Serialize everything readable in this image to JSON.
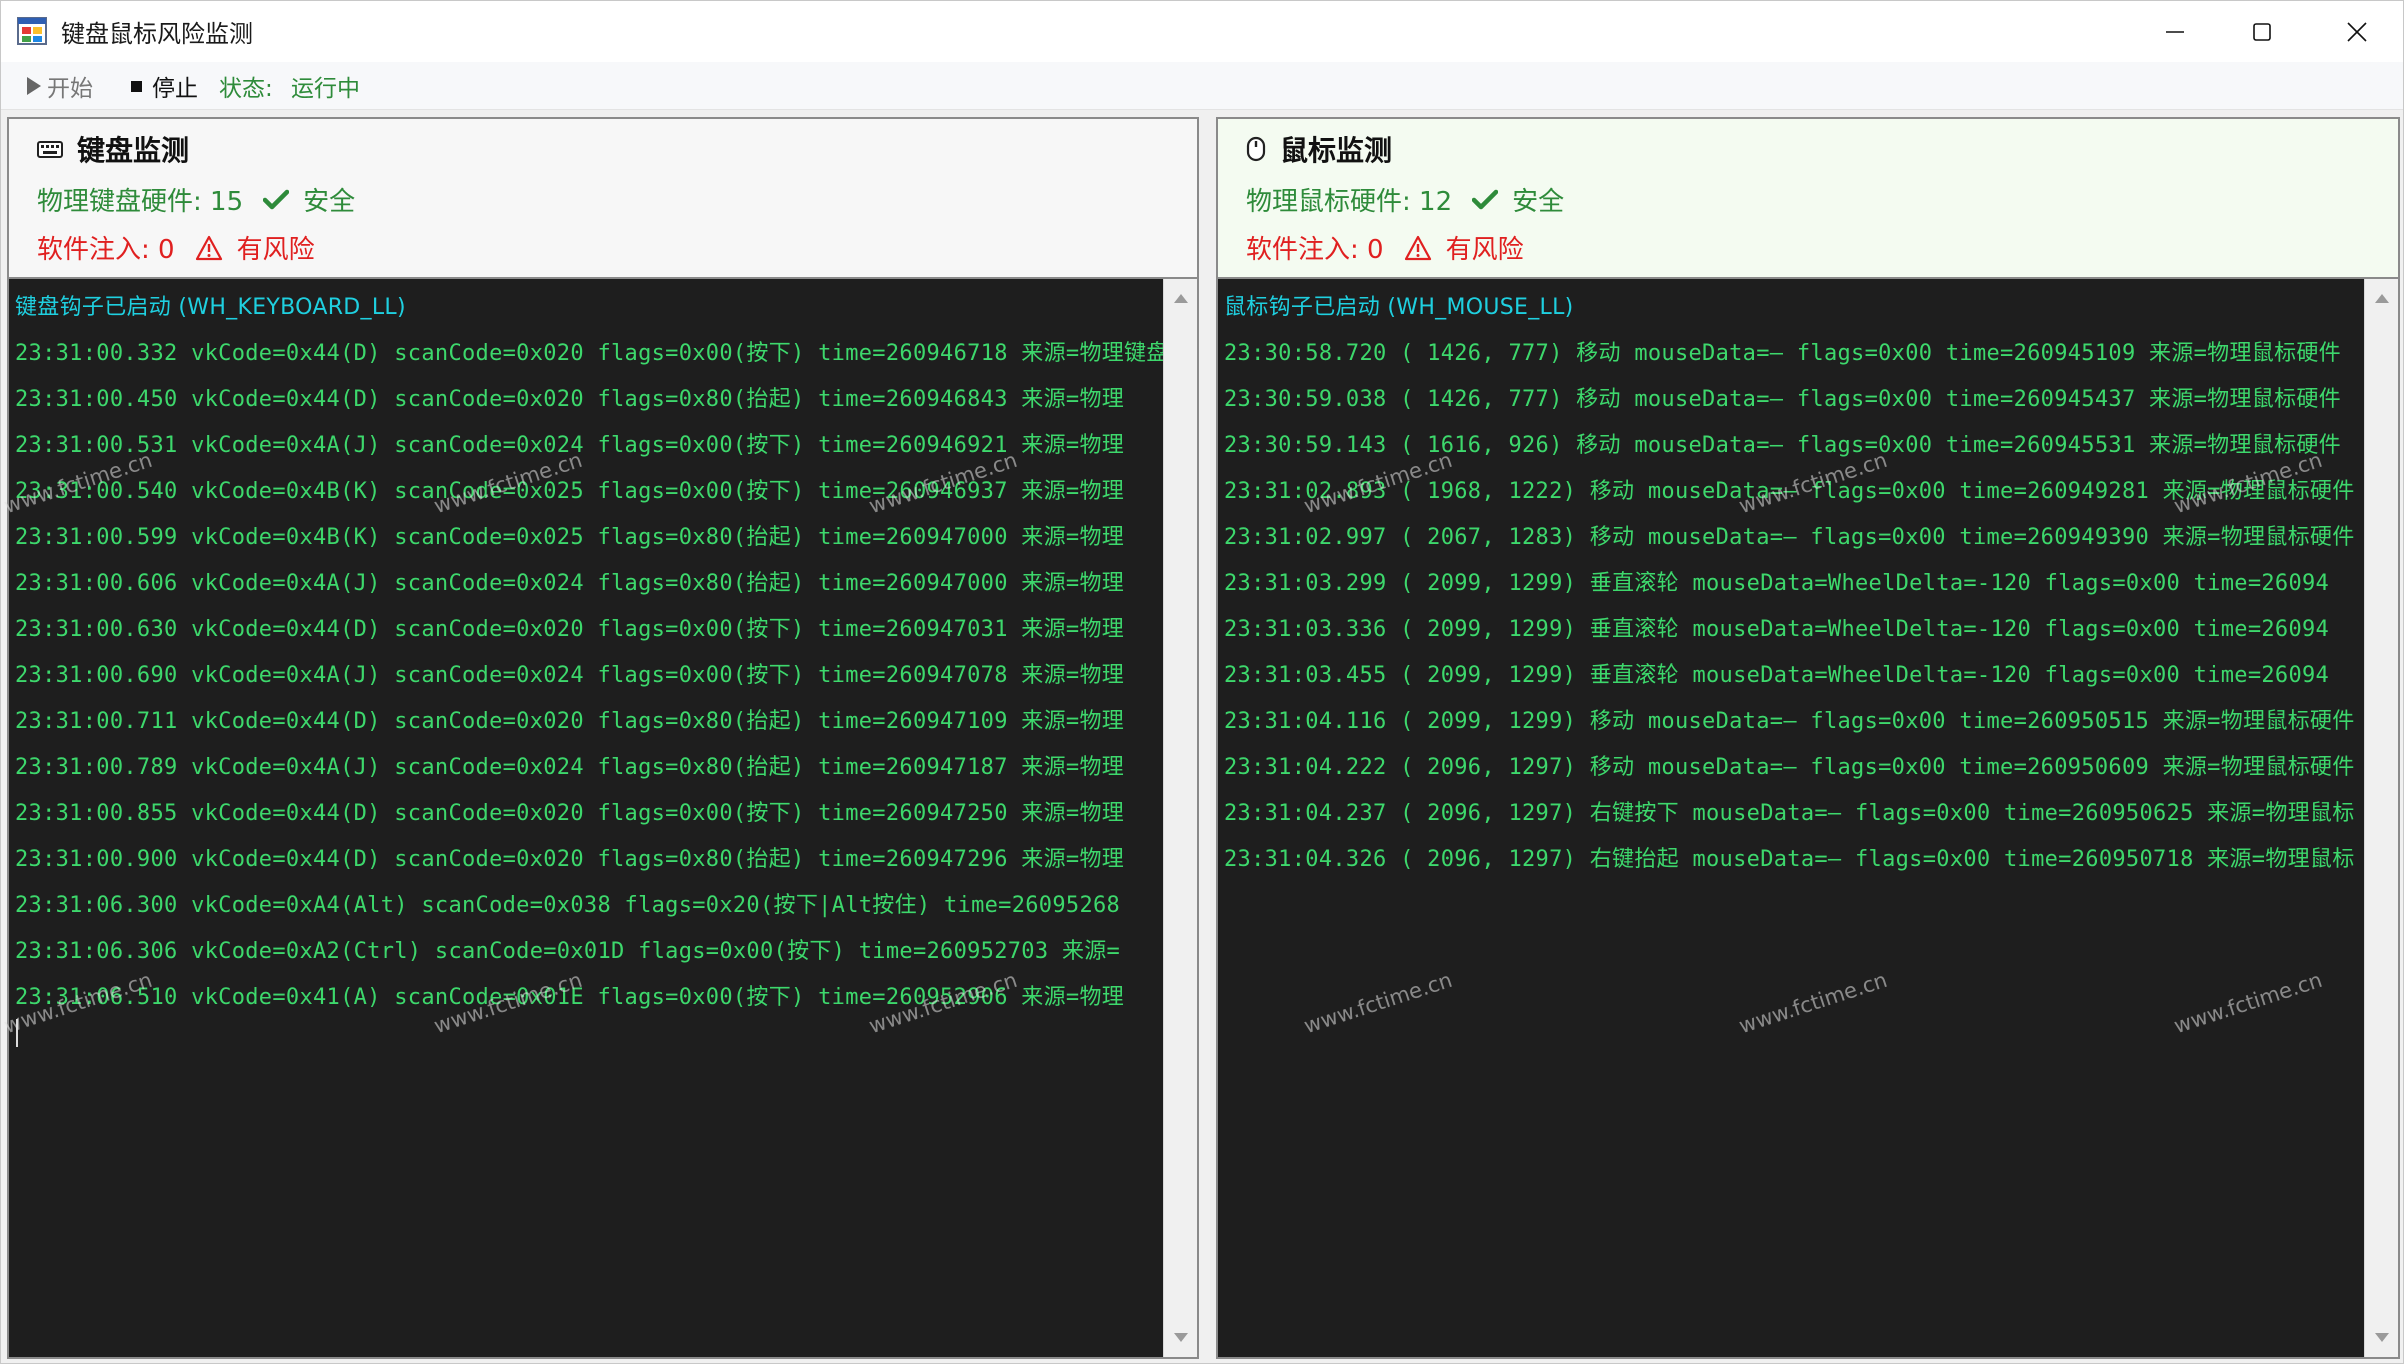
{
  "window": {
    "title": "键盘鼠标风险监测"
  },
  "toolbar": {
    "start_label": "开始",
    "stop_label": "停止",
    "status_label": "状态:",
    "status_value": "运行中"
  },
  "keyboard_panel": {
    "title": "键盘监测",
    "hardware_text": "物理键盘硬件: 15",
    "hardware_status": "安全",
    "injection_text": "软件注入: 0",
    "injection_status": "有风险",
    "log_header": "键盘钩子已启动 (WH_KEYBOARD_LL)",
    "log_lines": [
      "23:31:00.332 vkCode=0x44(D) scanCode=0x020 flags=0x00(按下) time=260946718 来源=物理键盘",
      "23:31:00.450 vkCode=0x44(D) scanCode=0x020 flags=0x80(抬起) time=260946843 来源=物理",
      "23:31:00.531 vkCode=0x4A(J) scanCode=0x024 flags=0x00(按下) time=260946921 来源=物理",
      "23:31:00.540 vkCode=0x4B(K) scanCode=0x025 flags=0x00(按下) time=260946937 来源=物理",
      "23:31:00.599 vkCode=0x4B(K) scanCode=0x025 flags=0x80(抬起) time=260947000 来源=物理",
      "23:31:00.606 vkCode=0x4A(J) scanCode=0x024 flags=0x80(抬起) time=260947000 来源=物理",
      "23:31:00.630 vkCode=0x44(D) scanCode=0x020 flags=0x00(按下) time=260947031 来源=物理",
      "23:31:00.690 vkCode=0x4A(J) scanCode=0x024 flags=0x00(按下) time=260947078 来源=物理",
      "23:31:00.711 vkCode=0x44(D) scanCode=0x020 flags=0x80(抬起) time=260947109 来源=物理",
      "23:31:00.789 vkCode=0x4A(J) scanCode=0x024 flags=0x80(抬起) time=260947187 来源=物理",
      "23:31:00.855 vkCode=0x44(D) scanCode=0x020 flags=0x00(按下) time=260947250 来源=物理",
      "23:31:00.900 vkCode=0x44(D) scanCode=0x020 flags=0x80(抬起) time=260947296 来源=物理",
      "23:31:06.300 vkCode=0xA4(Alt) scanCode=0x038 flags=0x20(按下|Alt按住) time=26095268",
      "23:31:06.306 vkCode=0xA2(Ctrl) scanCode=0x01D flags=0x00(按下) time=260952703 来源=",
      "23:31:06.510 vkCode=0x41(A) scanCode=0x01E flags=0x00(按下) time=260952906 来源=物理"
    ]
  },
  "mouse_panel": {
    "title": "鼠标监测",
    "hardware_text": "物理鼠标硬件: 12",
    "hardware_status": "安全",
    "injection_text": "软件注入: 0",
    "injection_status": "有风险",
    "log_header": "鼠标钩子已启动 (WH_MOUSE_LL)",
    "log_lines": [
      "23:30:58.720 ( 1426,  777) 移动 mouseData=— flags=0x00 time=260945109 来源=物理鼠标硬件",
      "23:30:59.038 ( 1426,  777) 移动 mouseData=— flags=0x00 time=260945437 来源=物理鼠标硬件",
      "23:30:59.143 ( 1616,  926) 移动 mouseData=— flags=0x00 time=260945531 来源=物理鼠标硬件",
      "23:31:02.893 ( 1968, 1222) 移动 mouseData=— flags=0x00 time=260949281 来源=物理鼠标硬件",
      "23:31:02.997 ( 2067, 1283) 移动 mouseData=— flags=0x00 time=260949390 来源=物理鼠标硬件",
      "23:31:03.299 ( 2099, 1299) 垂直滚轮 mouseData=WheelDelta=-120 flags=0x00 time=26094",
      "23:31:03.336 ( 2099, 1299) 垂直滚轮 mouseData=WheelDelta=-120 flags=0x00 time=26094",
      "23:31:03.455 ( 2099, 1299) 垂直滚轮 mouseData=WheelDelta=-120 flags=0x00 time=26094",
      "23:31:04.116 ( 2099, 1299) 移动 mouseData=— flags=0x00 time=260950515 来源=物理鼠标硬件",
      "23:31:04.222 ( 2096, 1297) 移动 mouseData=— flags=0x00 time=260950609 来源=物理鼠标硬件",
      "23:31:04.237 ( 2096, 1297) 右键按下 mouseData=— flags=0x00 time=260950625 来源=物理鼠标",
      "23:31:04.326 ( 2096, 1297) 右键抬起 mouseData=— flags=0x00 time=260950718 来源=物理鼠标"
    ]
  },
  "watermark_text": "www.fctime.cn",
  "colors": {
    "log_text": "#3dd86c",
    "log_header": "#1fd0e0",
    "log_background": "#1e1e1e",
    "safe": "#2e8b3a",
    "risk": "#e02020"
  },
  "icons": {
    "app": "app-window-icon",
    "keyboard": "keyboard-icon",
    "mouse": "mouse-icon",
    "safe": "check-icon",
    "risk": "warning-icon"
  }
}
